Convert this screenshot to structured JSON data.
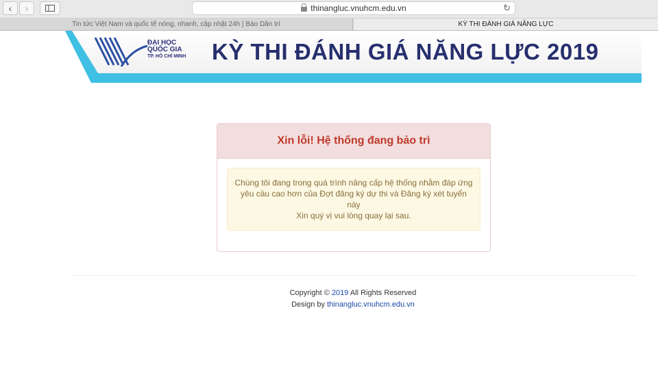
{
  "browser": {
    "address": "thinangluc.vnuhcm.edu.vn",
    "icons": {
      "back": "chevron-left-icon",
      "forward": "chevron-right-icon",
      "sidebar": "sidebar-icon",
      "lock": "lock-icon",
      "reload": "reload-icon"
    },
    "tabs": [
      {
        "label": "Tin tức Việt Nam và quốc tế nóng, nhanh, cập nhật 24h | Báo Dân trí"
      },
      {
        "label": "KỲ THI ĐÁNH GIÁ NĂNG LỰC"
      }
    ]
  },
  "banner": {
    "logo_line1": "ĐẠI HỌC",
    "logo_line2": "QUỐC GIA",
    "logo_line3": "TP. HỒ CHÍ MINH",
    "title": "KỲ THI ĐÁNH GIÁ NĂNG LỰC 2019",
    "colors": {
      "accent": "#3fbfe3",
      "navy": "#272f6e"
    }
  },
  "notice": {
    "heading": "Xin lỗi! Hệ thống đang bảo trì",
    "line1": "Chúng tôi đang trong quá trình nâng cấp hệ thống nhằm đáp ứng",
    "line2": "yêu cầu cao hơn của Đợt đăng ký dự thi và Đăng ký xét tuyển",
    "line3": "này",
    "line4": "Xin quý vị vui lòng quay lại sau.",
    "colors": {
      "heading": "#c0392b",
      "heading_bg": "#f2dede",
      "body_bg": "#fcf8e3",
      "body_text": "#8a6d3b"
    }
  },
  "footer": {
    "copyright_prefix": "Copyright ©",
    "year": "2019",
    "rights": "All Rights Reserved",
    "design_prefix": "Design by",
    "design_link": "thinangluc.vnuhcm.edu.vn"
  }
}
